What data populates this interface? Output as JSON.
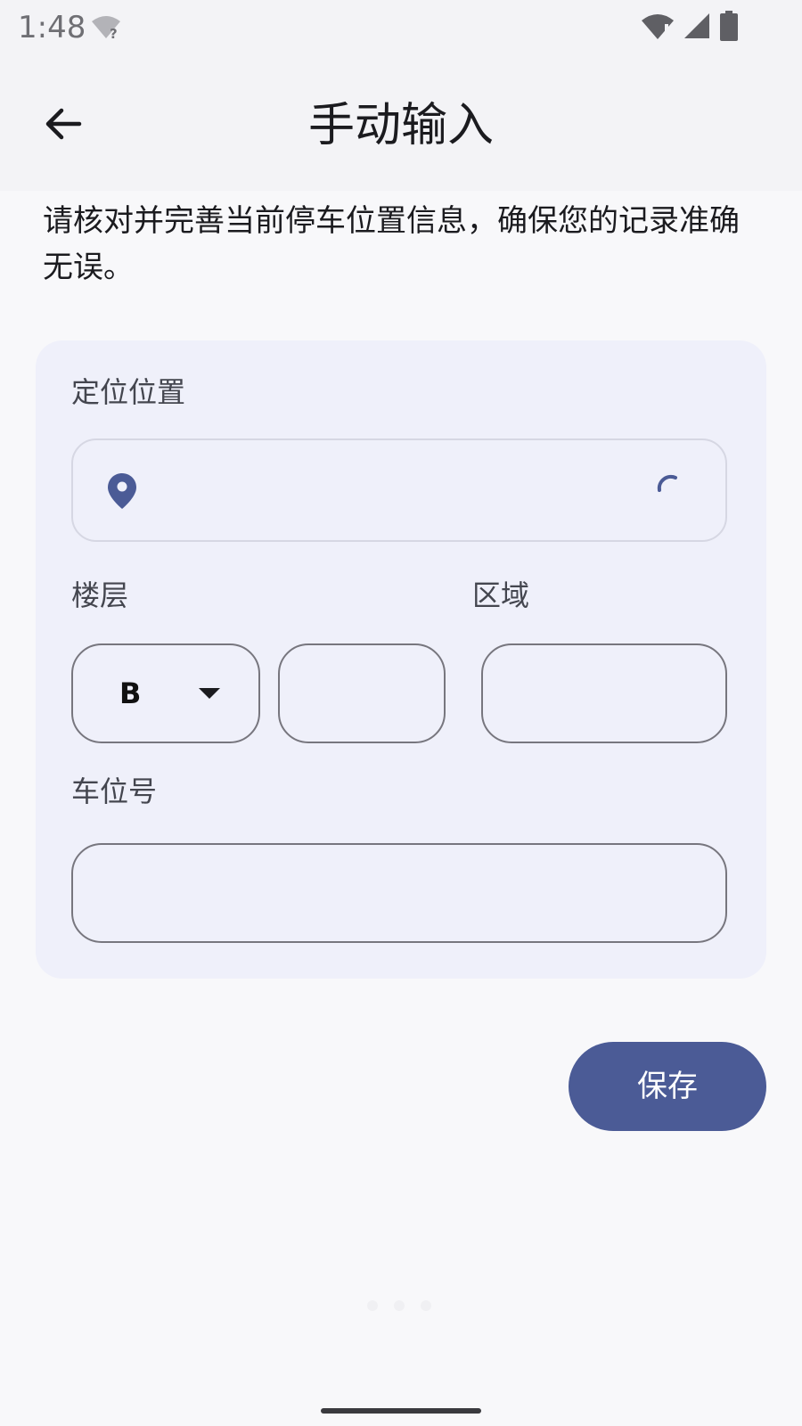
{
  "status_bar": {
    "time": "1:48",
    "icons": [
      "wifi-question-icon",
      "wifi-alert-icon",
      "signal-icon",
      "battery-icon"
    ]
  },
  "app_bar": {
    "back_icon": "arrow-left-icon",
    "title": "手动输入"
  },
  "description": "请核对并完善当前停车位置信息，确保您的记录准确无误。",
  "form": {
    "location": {
      "label": "定位位置",
      "value": "",
      "icon": "location-pin-icon",
      "status_icon": "loading-spinner-icon"
    },
    "floor": {
      "label": "楼层",
      "prefix_value": "B",
      "number_value": ""
    },
    "zone": {
      "label": "区域",
      "value": ""
    },
    "spot": {
      "label": "车位号",
      "value": ""
    }
  },
  "save_button": {
    "label": "保存"
  },
  "colors": {
    "accent": "#4b5b96",
    "card_background": "#eff0fa",
    "page_background": "#f8f8fa"
  }
}
